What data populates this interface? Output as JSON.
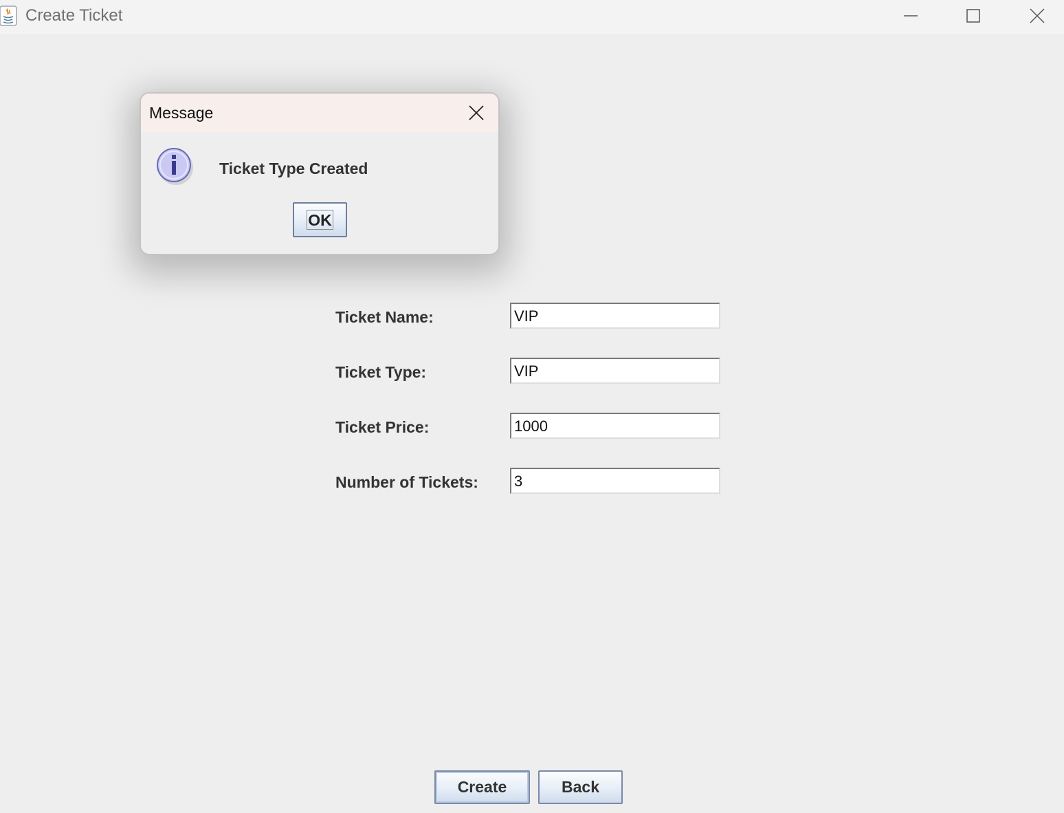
{
  "window": {
    "title": "Create Ticket",
    "icons": [
      "java-app-icon",
      "minimize-icon",
      "maximize-icon",
      "close-icon"
    ]
  },
  "form": {
    "fields": [
      {
        "label": "Ticket Name:",
        "value": "VIP"
      },
      {
        "label": "Ticket Type:",
        "value": "VIP"
      },
      {
        "label": "Ticket Price:",
        "value": "1000"
      },
      {
        "label": "Number of Tickets:",
        "value": "3"
      }
    ],
    "create_label": "Create",
    "back_label": "Back"
  },
  "dialog": {
    "title": "Message",
    "message": "Ticket Type Created",
    "ok_label": "OK",
    "icon": "info-icon"
  },
  "colors": {
    "background": "#eeeeee",
    "dialog_titlebar": "#f8efec",
    "info_icon": "#c9c9f3"
  }
}
